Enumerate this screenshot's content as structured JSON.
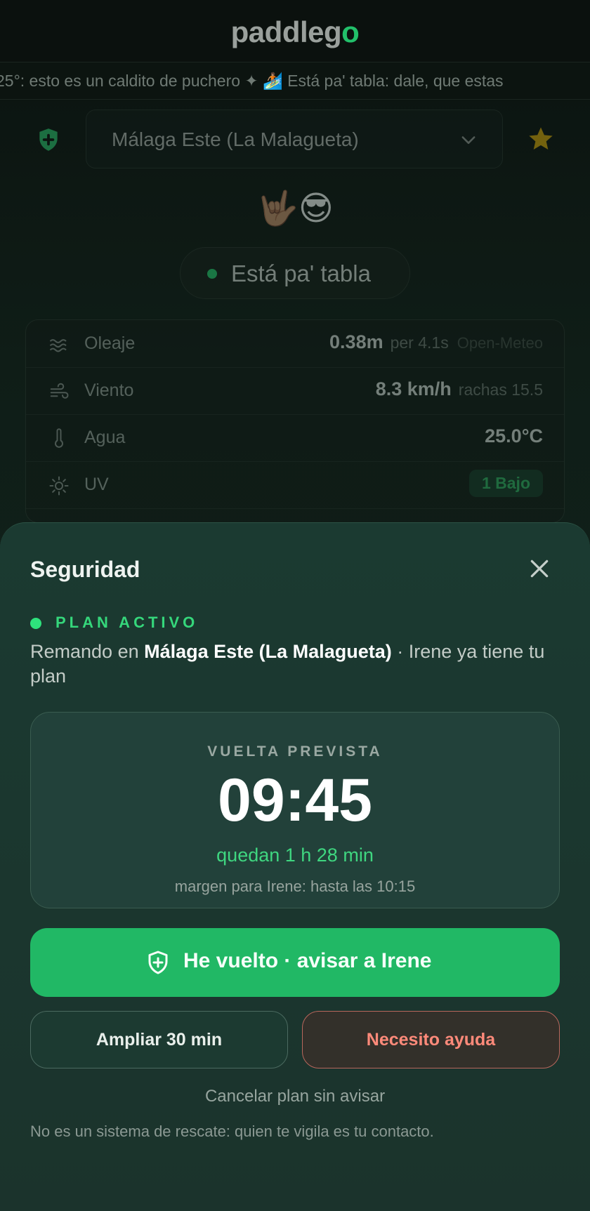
{
  "header": {
    "logo_main": "paddleg",
    "logo_accent": "o"
  },
  "ticker": {
    "text": "25°: esto es un caldito de puchero ✦ 🏄🏽 Está pa' tabla: dale, que estas"
  },
  "spot": {
    "selected": "Málaga Este (La Malagueta)"
  },
  "mood": {
    "emojis": "🤟🏽😎"
  },
  "status": {
    "label": "Está pa' tabla",
    "color": "#26c46c"
  },
  "metrics": {
    "oleaje": {
      "label": "Oleaje",
      "value": "0.38m",
      "sub": "per 4.1s",
      "source": "Open-Meteo"
    },
    "viento": {
      "label": "Viento",
      "value": "8.3 km/h",
      "sub": "rachas 15.5"
    },
    "agua": {
      "label": "Agua",
      "value": "25.0°C"
    },
    "uv": {
      "label": "UV",
      "value": "1 Bajo"
    }
  },
  "sheet": {
    "title": "Seguridad",
    "plan_label": "PLAN ACTIVO",
    "plan_prefix": "Remando en ",
    "plan_spot": "Málaga Este (La Malagueta)",
    "plan_suffix": " · Irene ya tiene tu plan",
    "card": {
      "label": "VUELTA PREVISTA",
      "time": "09:45",
      "remaining": "quedan 1 h 28 min",
      "margin": "margen para Irene: hasta las 10:15"
    },
    "primary_button": "He vuelto · avisar a Irene",
    "extend_button": "Ampliar 30 min",
    "help_button": "Necesito ayuda",
    "cancel_link": "Cancelar plan sin avisar",
    "disclaimer": "No es un sistema de rescate: quien te vigila es tu contacto."
  },
  "colors": {
    "accent": "#21b865",
    "danger": "#ff8a7a",
    "star": "#c9a10c"
  }
}
